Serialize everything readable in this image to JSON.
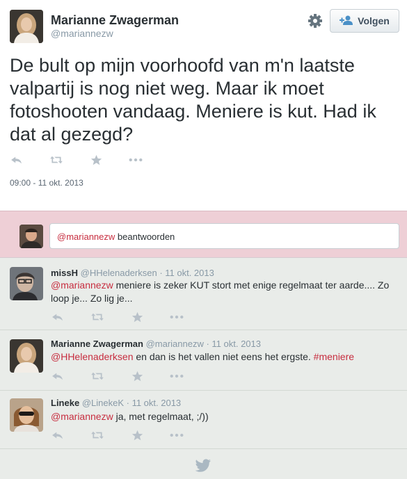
{
  "tweet": {
    "author_name": "Marianne Zwagerman",
    "author_handle": "@mariannezw",
    "follow_label": "Volgen",
    "text": "De bult op mijn voorhoofd van m'n laatste valpartij is nog niet weg. Maar ik moet fotoshooten vandaag. Meniere is kut. Had ik dat al gezegd?",
    "timestamp": "09:00 - 11 okt. 2013"
  },
  "reply_box": {
    "mention": "@mariannezw",
    "label": " beantwoorden"
  },
  "replies": [
    {
      "name": "missH",
      "handle": "@HHelenaderksen",
      "date": "· 11 okt. 2013",
      "mention": "@mariannezw",
      "text": " meniere is zeker KUT stort met enige regelmaat ter aarde.... Zo loop je... Zo lig je..."
    },
    {
      "name": "Marianne Zwagerman",
      "handle": "@mariannezw",
      "date": "· 11 okt. 2013",
      "mention": "@HHelenaderksen",
      "text": " en dan is het vallen niet eens het ergste. ",
      "hashtag": "#meniere"
    },
    {
      "name": "Lineke",
      "handle": "@LinekeK",
      "date": "· 11 okt. 2013",
      "mention": "@mariannezw",
      "text": " ja, met regelmaat,  ;/))"
    }
  ],
  "colors": {
    "mention": "#c72d3f",
    "reply_box_bg": "#eecfd6",
    "thread_bg": "#e9ece9",
    "icon": "#b8c1c9"
  },
  "icons": [
    "gear-icon",
    "follow-user-icon",
    "reply-icon",
    "retweet-icon",
    "favorite-icon",
    "more-icon",
    "twitter-bird-icon"
  ]
}
